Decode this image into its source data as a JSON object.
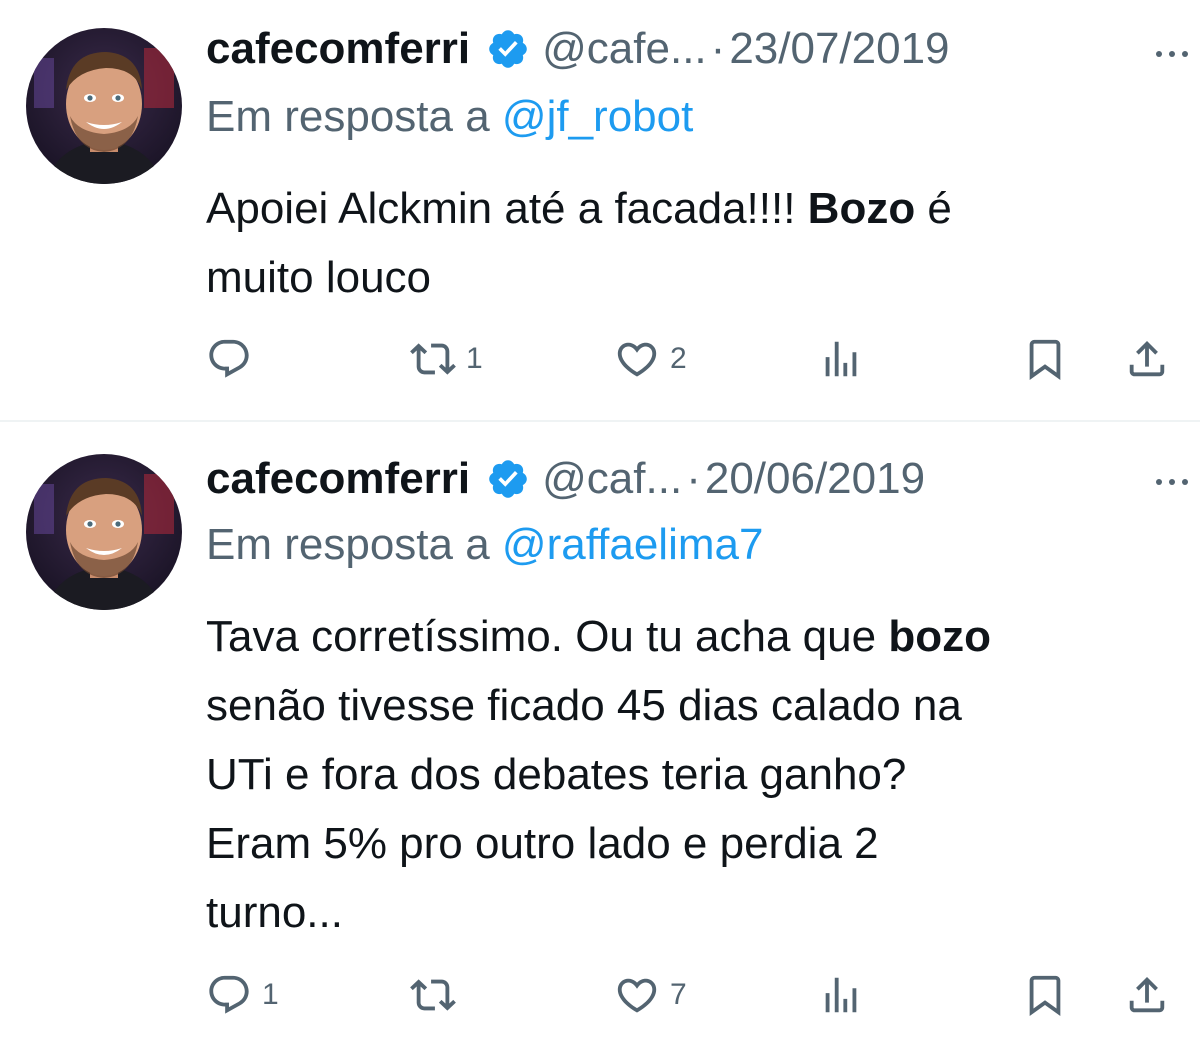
{
  "tweets": [
    {
      "name": "cafecomferri",
      "handle": "@cafe...",
      "separator": "·",
      "date": "23/07/2019",
      "reply_prefix": "Em resposta a",
      "reply_mention": "@jf_robot",
      "text_line1_before": "Apoiei Alckmin até a facada!!!! ",
      "text_line1_bold": "Bozo",
      "text_line1_after": " é",
      "text_line2": "muito louco",
      "replies": "",
      "retweets": "1",
      "likes": "2",
      "icons": [
        "verified-badge-icon",
        "more-icon",
        "reply-icon",
        "retweet-icon",
        "like-icon",
        "views-icon",
        "bookmark-icon",
        "share-icon"
      ]
    },
    {
      "name": "cafecomferri",
      "handle": "@caf...",
      "separator": "·",
      "date": "20/06/2019",
      "reply_prefix": "Em resposta a",
      "reply_mention": "@raffaelima7",
      "text_line1_before": "Tava corretíssimo. Ou tu acha que ",
      "text_line1_bold": "bozo",
      "text_line2": "senão tivesse ficado 45 dias calado na",
      "text_line3": "UTi e fora dos debates teria ganho?",
      "text_line4": "Eram 5% pro outro lado e perdia 2",
      "text_line5": "turno...",
      "replies": "1",
      "retweets": "",
      "likes": "7"
    }
  ],
  "colors": {
    "text": "#0f1419",
    "secondary": "#536471",
    "accent": "#1d9bf0",
    "divider": "#eff3f4"
  }
}
